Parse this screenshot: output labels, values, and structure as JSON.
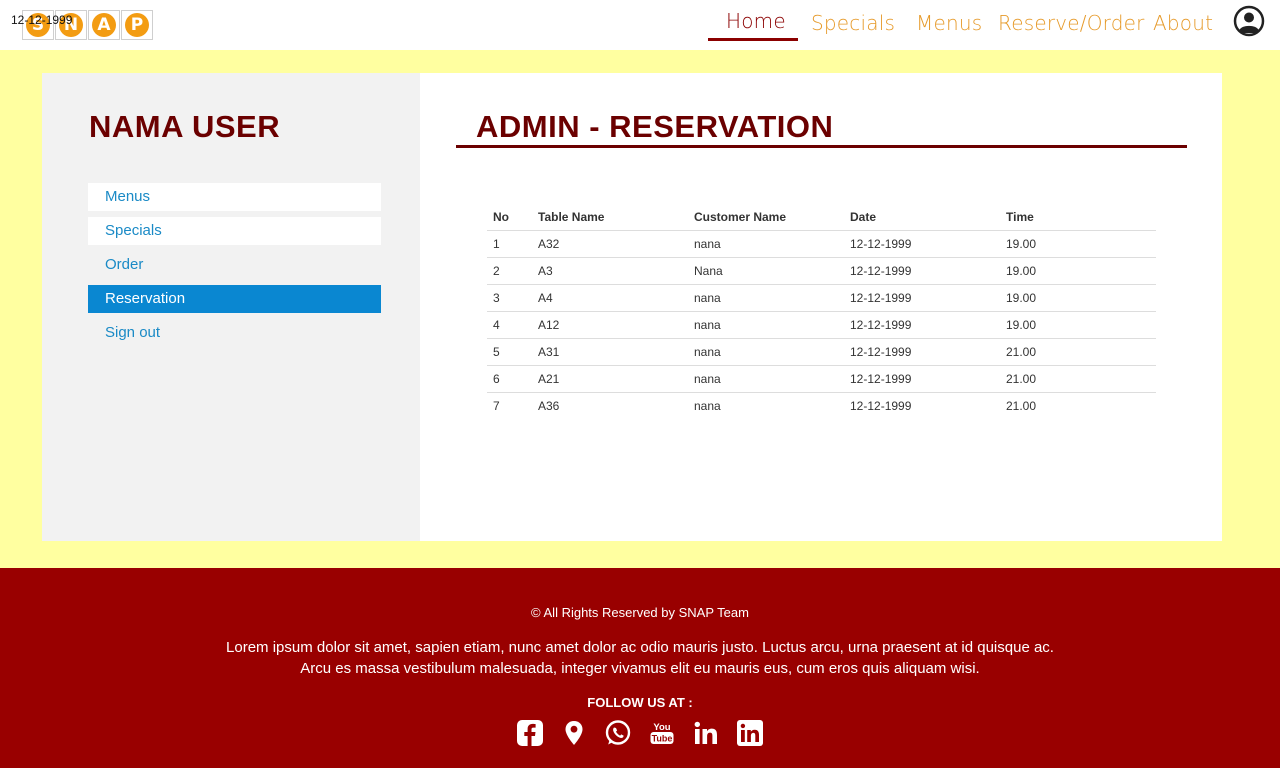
{
  "brand": {
    "letters": [
      "S",
      "N",
      "A",
      "P"
    ],
    "date": "12-12-1999",
    "accent": "#f39c12"
  },
  "nav": {
    "items": [
      {
        "label": "Home",
        "active": true
      },
      {
        "label": "Specials"
      },
      {
        "label": "Menus"
      },
      {
        "label": "Reserve/Order"
      },
      {
        "label": "About"
      }
    ],
    "profile_icon": "user-circle-icon"
  },
  "sidebar": {
    "title": "NAMA USER",
    "items": [
      {
        "label": "Menus"
      },
      {
        "label": "Specials"
      },
      {
        "label": "Order"
      },
      {
        "label": "Reservation",
        "active": true
      },
      {
        "label": "Sign out"
      }
    ]
  },
  "content": {
    "title": "ADMIN - RESERVATION",
    "table": {
      "headers": [
        "No",
        "Table Name",
        "Customer Name",
        "Date",
        "Time"
      ],
      "rows": [
        [
          "1",
          "A32",
          "nana",
          "12-12-1999",
          "19.00"
        ],
        [
          "2",
          "A3",
          "Nana",
          "12-12-1999",
          "19.00"
        ],
        [
          "3",
          "A4",
          "nana",
          "12-12-1999",
          "19.00"
        ],
        [
          "4",
          "A12",
          "nana",
          "12-12-1999",
          "19.00"
        ],
        [
          "5",
          "A31",
          "nana",
          "12-12-1999",
          "21.00"
        ],
        [
          "6",
          "A21",
          "nana",
          "12-12-1999",
          "21.00"
        ],
        [
          "7",
          "A36",
          "nana",
          "12-12-1999",
          "21.00"
        ]
      ]
    }
  },
  "footer": {
    "copyright": "© All Rights Reserved by SNAP Team",
    "lorem_line1": "Lorem ipsum dolor sit amet, sapien etiam, nunc amet dolor ac odio mauris justo. Luctus arcu, urna praesent at id quisque ac.",
    "lorem_line2": "Arcu es massa vestibulum malesuada, integer vivamus elit eu mauris eus, cum eros quis aliquam wisi.",
    "follow": "FOLLOW US AT :",
    "socials": [
      "facebook-icon",
      "location-pin-icon",
      "whatsapp-icon",
      "youtube-icon",
      "linkedin-icon",
      "linkedin-box-icon"
    ]
  },
  "colors": {
    "primary": "#990000",
    "title": "#6b0000",
    "background": "#ffffa0",
    "link": "#1a8ac6",
    "active_menu": "#0a87d1"
  }
}
